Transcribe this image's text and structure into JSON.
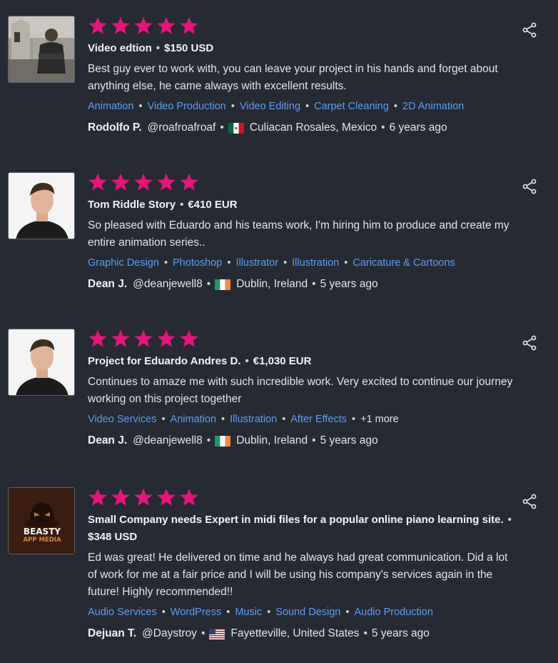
{
  "reviews": [
    {
      "stars": 5,
      "title": "Video edtion",
      "price": "$150 USD",
      "body": "Best guy ever to work with, you can leave your project in his hands and forget about anything else, he came always with excellent results.",
      "tags": [
        "Animation",
        "Video Production",
        "Video Editing",
        "Carpet Cleaning",
        "2D Animation"
      ],
      "more": "",
      "reviewer": "Rodolfo P.",
      "handle": "@roafroafroaf",
      "country_flag": "mexico-flag",
      "location": "Culiacan Rosales, Mexico",
      "time": "6 years ago"
    },
    {
      "stars": 5,
      "title": "Tom Riddle Story",
      "price": "€410 EUR",
      "body": "So pleased with Eduardo and his teams work, I'm hiring him to produce and create my entire animation series..",
      "tags": [
        "Graphic Design",
        "Photoshop",
        "Illustrator",
        "Illustration",
        "Caricature & Cartoons"
      ],
      "more": "",
      "reviewer": "Dean J.",
      "handle": "@deanjewell8",
      "country_flag": "ireland-flag",
      "location": "Dublin, Ireland",
      "time": "5 years ago"
    },
    {
      "stars": 5,
      "title": "Project for Eduardo Andres D.",
      "price": "€1,030 EUR",
      "body": "Continues to amaze me with such incredible work. Very excited to continue our journey working on this project together",
      "tags": [
        "Video Services",
        "Animation",
        "Illustration",
        "After Effects"
      ],
      "more": "+1 more",
      "reviewer": "Dean J.",
      "handle": "@deanjewell8",
      "country_flag": "ireland-flag",
      "location": "Dublin, Ireland",
      "time": "5 years ago"
    },
    {
      "stars": 5,
      "title": "Small Company needs Expert in midi files for a popular online piano learning site.",
      "price": "$348 USD",
      "body": "Ed was great! He delivered on time and he always had great communication. Did a lot of work for me at a fair price and I will be using his company's services again in the future! Highly recommended!!",
      "tags": [
        "Audio Services",
        "WordPress",
        "Music",
        "Sound Design",
        "Audio Production"
      ],
      "more": "",
      "reviewer": "Dejuan T.",
      "handle": "@Daystroy",
      "country_flag": "usa-flag",
      "location": "Fayetteville, United States",
      "time": "5 years ago"
    }
  ],
  "logo": {
    "line1": "BEASTY",
    "line2": "APP MEDIA"
  },
  "colors": {
    "star": "#e8137c",
    "tag": "#5b9cf6",
    "background": "#262b33"
  }
}
